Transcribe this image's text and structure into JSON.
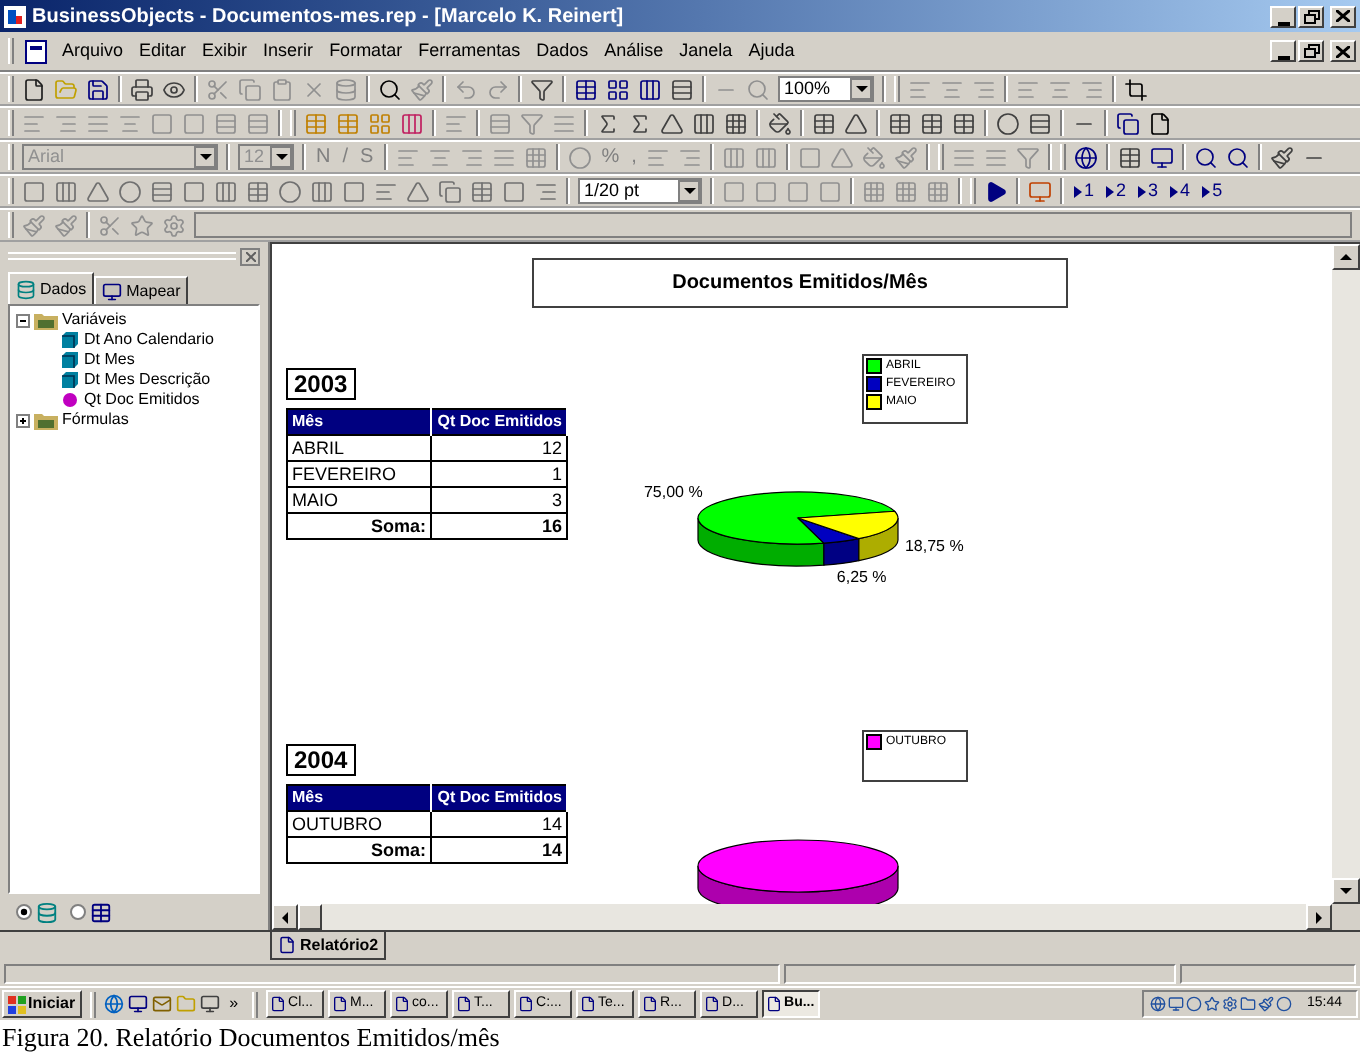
{
  "window": {
    "title": "BusinessObjects - Documentos-mes.rep - [Marcelo K. Reinert]"
  },
  "menu": [
    "Arquivo",
    "Editar",
    "Exibir",
    "Inserir",
    "Formatar",
    "Ferramentas",
    "Dados",
    "Análise",
    "Janela",
    "Ajuda"
  ],
  "toolbar": {
    "zoom": "100%",
    "font": {
      "value": "Arial",
      "disabled": true
    },
    "font_size": {
      "value": "12",
      "disabled": true
    },
    "format_buttons": [
      "N",
      "/",
      "S"
    ],
    "number_buttons": [
      "%",
      ","
    ],
    "line_width": "1/20 pt",
    "page_buttons": [
      "1",
      "2",
      "3",
      "4",
      "5"
    ]
  },
  "side_panel": {
    "tabs": [
      {
        "label": "Dados",
        "selected": true
      },
      {
        "label": "Mapear",
        "selected": false
      }
    ],
    "tree": [
      {
        "label": "Variáveis",
        "expanded": true,
        "children": [
          {
            "label": "Dt Ano Calendario",
            "kind": "dimension"
          },
          {
            "label": "Dt Mes",
            "kind": "dimension"
          },
          {
            "label": "Dt Mes Descrição",
            "kind": "dimension"
          },
          {
            "label": "Qt Doc Emitidos",
            "kind": "measure"
          }
        ]
      },
      {
        "label": "Fórmulas",
        "expanded": false
      }
    ],
    "view_options": [
      {
        "kind": "data",
        "selected": true
      },
      {
        "kind": "structure",
        "selected": false
      }
    ]
  },
  "report": {
    "title": "Documentos Emitidos/Mês",
    "sections": [
      {
        "year": "2003",
        "table": {
          "columns": [
            "Mês",
            "Qt Doc Emitidos"
          ],
          "rows": [
            [
              "ABRIL",
              "12"
            ],
            [
              "FEVEREIRO",
              "1"
            ],
            [
              "MAIO",
              "3"
            ]
          ],
          "total": {
            "label": "Soma:",
            "value": "16"
          }
        },
        "legend": [
          {
            "label": "ABRIL",
            "color": "#00ff00"
          },
          {
            "label": "FEVEREIRO",
            "color": "#0000c0"
          },
          {
            "label": "MAIO",
            "color": "#ffff00"
          }
        ],
        "pie_labels": [
          "75,00 %",
          "6,25 %",
          "18,75 %"
        ]
      },
      {
        "year": "2004",
        "table": {
          "columns": [
            "Mês",
            "Qt Doc Emitidos"
          ],
          "rows": [
            [
              "OUTUBRO",
              "14"
            ]
          ],
          "total": {
            "label": "Soma:",
            "value": "14"
          }
        },
        "legend": [
          {
            "label": "OUTUBRO",
            "color": "#ff00ff"
          }
        ]
      }
    ]
  },
  "tabs": [
    {
      "label": "Relatório2",
      "selected": true
    }
  ],
  "taskbar": {
    "start": "Iniciar",
    "more": "»",
    "tasks": [
      {
        "label": "Cl...",
        "selected": false
      },
      {
        "label": "M...",
        "selected": false
      },
      {
        "label": "co...",
        "selected": false
      },
      {
        "label": "T...",
        "selected": false
      },
      {
        "label": "C:...",
        "selected": false
      },
      {
        "label": "Te...",
        "selected": false
      },
      {
        "label": "R...",
        "selected": false
      },
      {
        "label": "D...",
        "selected": false
      },
      {
        "label": "Bu...",
        "selected": true
      }
    ],
    "clock": "15:44"
  },
  "caption": "Figura 20. Relatório Documentos Emitidos/mês"
}
